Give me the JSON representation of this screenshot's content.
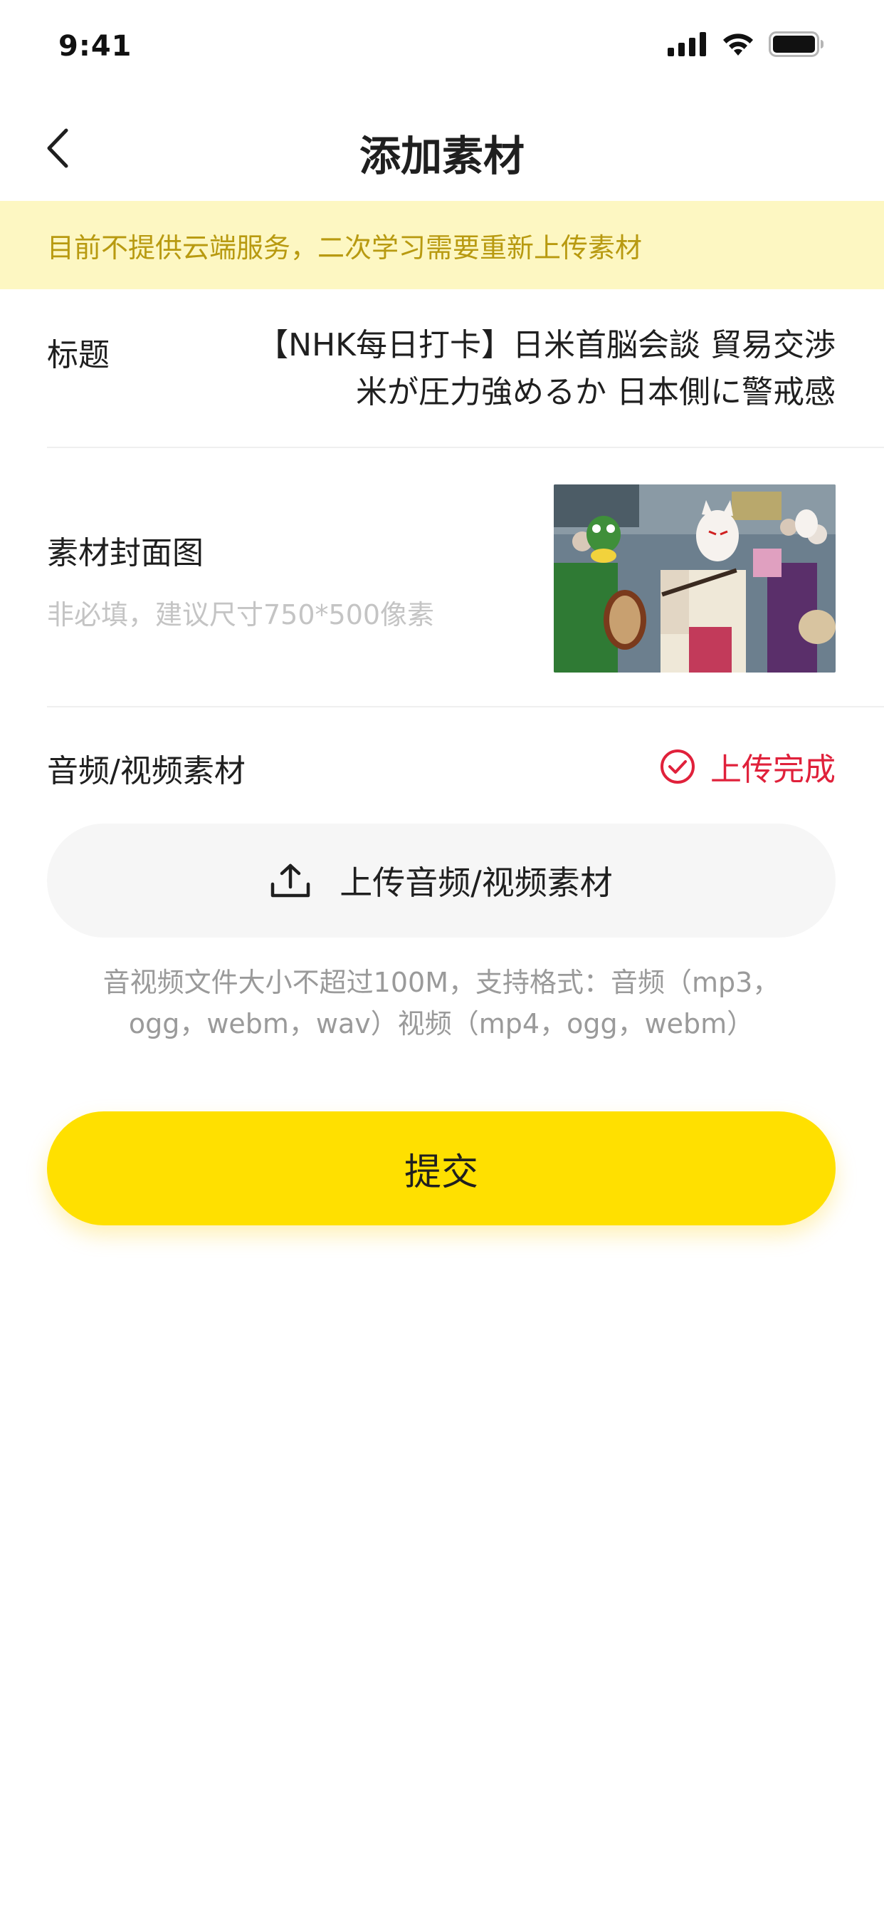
{
  "status_bar": {
    "time": "9:41",
    "icons": [
      "signal-icon",
      "wifi-icon",
      "battery-icon"
    ]
  },
  "nav": {
    "title": "添加素材",
    "back_icon": "chevron-left-icon"
  },
  "notice": {
    "text": "目前不提供云端服务，二次学习需要重新上传素材",
    "bg_color": "#fdf7c2",
    "text_color": "#b89a10"
  },
  "form": {
    "title_row": {
      "label": "标题",
      "value_line1": "【NHK每日打卡】日米首脳会談 貿易交渉",
      "value_line2": "米が圧力強めるか 日本側に警戒感"
    },
    "cover_row": {
      "label": "素材封面图",
      "hint": "非必填，建议尺寸750*500像素"
    },
    "media_row": {
      "label": "音频/视频素材",
      "status_text": "上传完成",
      "status_color": "#e0213b",
      "status_icon": "check-circle-icon"
    },
    "upload_button": {
      "label": "上传音频/视频素材",
      "icon": "upload-icon"
    },
    "format_note": {
      "line1": "音视频文件大小不超过100M，支持格式：音频（mp3，",
      "line2": "ogg，webm，wav）视频（mp4，ogg，webm）"
    }
  },
  "submit": {
    "label": "提交",
    "color": "#ffe000"
  }
}
